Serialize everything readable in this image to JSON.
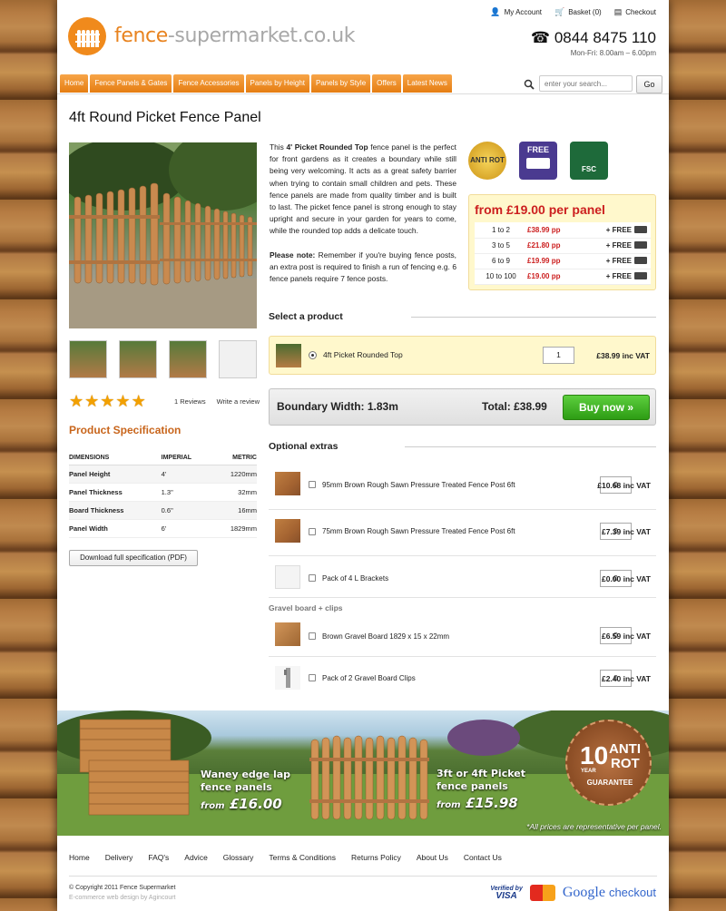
{
  "header": {
    "logo_text_a": "fence",
    "logo_text_b": "-supermarket.co.uk",
    "links": {
      "account": "My Account",
      "basket": "Basket (0)",
      "checkout": "Checkout"
    },
    "phone": "0844 8475 110",
    "hours": "Mon-Fri: 8.00am – 6.00pm"
  },
  "nav": {
    "items": [
      "Home",
      "Fence Panels & Gates",
      "Fence Accessories",
      "Panels by Height",
      "Panels by Style",
      "Offers",
      "Latest News"
    ],
    "search_placeholder": "enter your search...",
    "go_label": "Go"
  },
  "product": {
    "title": "4ft Round Picket Fence Panel",
    "desc_intro": "This ",
    "desc_bold": "4' Picket Rounded Top",
    "desc_rest": " fence panel is the perfect for front gardens as it creates a boundary while still being very welcoming. It acts as a great safety barrier when trying to contain small children and pets. These fence panels are made from quality timber and is built to last. The picket fence panel is strong enough to stay upright and secure in your garden for years to come, while the rounded top adds a delicate touch.",
    "note_bold": "Please note:",
    "note_rest": " Remember if you're buying fence posts, an extra post is required to finish a run of fencing e.g. 6 fence panels require 7 fence posts.",
    "reviews": "1 Reviews",
    "write_review": "Write a review",
    "rating": 5
  },
  "badges": {
    "anti": "ANTI ROT",
    "free": "FREE",
    "fsc": "FSC"
  },
  "pricing": {
    "heading": "from £19.00 per panel",
    "rows": [
      {
        "qty": "1 to 2",
        "price": "£38.99 pp",
        "free": "+ FREE"
      },
      {
        "qty": "3 to 5",
        "price": "£21.80 pp",
        "free": "+ FREE"
      },
      {
        "qty": "6 to 9",
        "price": "£19.99 pp",
        "free": "+ FREE"
      },
      {
        "qty": "10 to 100",
        "price": "£19.00 pp",
        "free": "+ FREE"
      }
    ]
  },
  "spec": {
    "title": "Product Specification",
    "headers": [
      "DIMENSIONS",
      "IMPERIAL",
      "METRIC"
    ],
    "rows": [
      [
        "Panel Height",
        "4'",
        "1220mm"
      ],
      [
        "Panel Thickness",
        "1.3\"",
        "32mm"
      ],
      [
        "Board Thickness",
        "0.6\"",
        "16mm"
      ],
      [
        "Panel Width",
        "6'",
        "1829mm"
      ]
    ],
    "download": "Download full specification (PDF)"
  },
  "select": {
    "heading": "Select a product",
    "name": "4ft Picket Rounded Top",
    "qty": "1",
    "price": "£38.99 inc VAT"
  },
  "buy": {
    "width_label": "Boundary Width: 1.83m",
    "total_label": "Total: £38.99",
    "button": "Buy now »"
  },
  "extras": {
    "heading": "Optional extras",
    "items": [
      {
        "name": "95mm Brown Rough Sawn Pressure Treated Fence Post 6ft",
        "qty": "0",
        "price": "£10.68 inc VAT"
      },
      {
        "name": "75mm Brown Rough Sawn Pressure Treated Fence Post 6ft",
        "qty": "0",
        "price": "£7.39 inc VAT"
      },
      {
        "name": "Pack of 4 L Brackets",
        "qty": "0",
        "price": "£0.00 inc VAT"
      }
    ],
    "gravel_heading": "Gravel board + clips",
    "gravel_items": [
      {
        "name": "Brown Gravel Board 1829 x 15 x 22mm",
        "qty": "0",
        "price": "£6.59 inc VAT"
      },
      {
        "name": "Pack of 2 Gravel Board Clips",
        "qty": "0",
        "price": "£2.40 inc VAT"
      }
    ]
  },
  "banner": {
    "waney_line1": "Waney edge lap",
    "waney_line2": "fence panels",
    "waney_from": "from",
    "waney_price": "£16.00",
    "picket_line1": "3ft or 4ft Picket",
    "picket_line2": "fence panels",
    "picket_from": "from",
    "picket_price": "£15.98",
    "seal_num": "10",
    "seal_year": "YEAR",
    "seal_anti": "ANTI",
    "seal_rot": "ROT",
    "seal_guarantee": "GUARANTEE",
    "disclaimer": "*All prices are representative per panel."
  },
  "footer": {
    "links": [
      "Home",
      "Delivery",
      "FAQ's",
      "Advice",
      "Glossary",
      "Terms & Conditions",
      "Returns Policy",
      "About Us",
      "Contact Us"
    ],
    "copyright": "© Copyright 2011 Fence Supermarket",
    "credit": "E-commerce web design by Agincourt",
    "visa_top": "Verified by",
    "visa_bottom": "VISA",
    "mastercard": "MasterCard",
    "google": "Google",
    "google_checkout": "checkout"
  },
  "colors": {
    "accent": "#e8831f",
    "price_red": "#cc1f1f",
    "buy_green": "#35a61b"
  }
}
